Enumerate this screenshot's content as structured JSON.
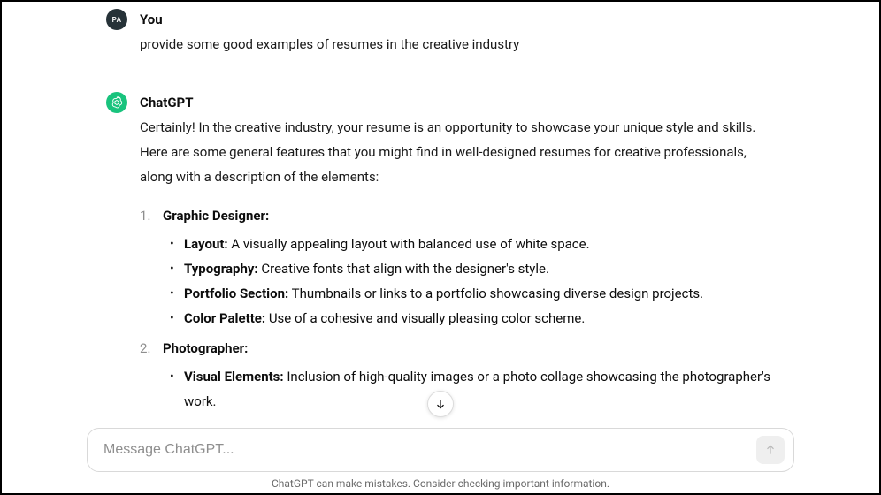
{
  "user": {
    "avatar_initials": "PA",
    "sender_label": "You",
    "message": "provide some good examples of resumes in the creative industry"
  },
  "assistant": {
    "sender_label": "ChatGPT",
    "intro": "Certainly! In the creative industry, your resume is an opportunity to showcase your unique style and skills. Here are some general features that you might find in well-designed resumes for creative professionals, along with a description of the elements:",
    "items": [
      {
        "title": "Graphic Designer:",
        "bullets": [
          {
            "k": "Layout:",
            "v": " A visually appealing layout with balanced use of white space."
          },
          {
            "k": "Typography:",
            "v": " Creative fonts that align with the designer's style."
          },
          {
            "k": "Portfolio Section:",
            "v": " Thumbnails or links to a portfolio showcasing diverse design projects."
          },
          {
            "k": "Color Palette:",
            "v": " Use of a cohesive and visually pleasing color scheme."
          }
        ]
      },
      {
        "title": "Photographer:",
        "bullets": [
          {
            "k": "Visual Elements:",
            "v": " Inclusion of high-quality images or a photo collage showcasing the photographer's work."
          }
        ]
      }
    ]
  },
  "composer": {
    "placeholder": "Message ChatGPT..."
  },
  "footer": {
    "disclaimer": "ChatGPT can make mistakes. Consider checking important information."
  }
}
